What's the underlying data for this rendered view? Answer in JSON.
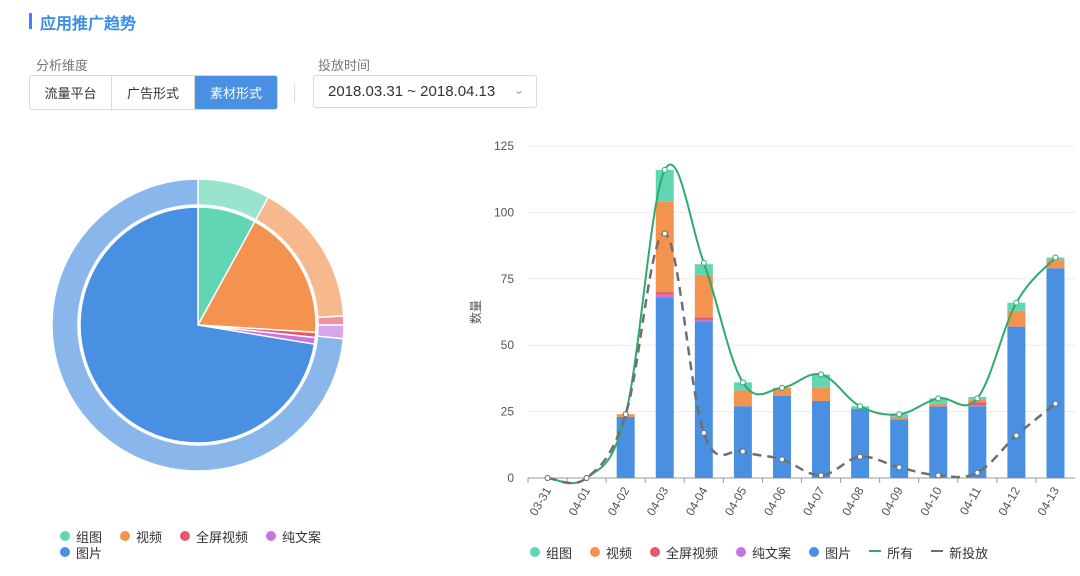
{
  "header": {
    "title": "应用推广趋势"
  },
  "filters": {
    "dimension_label": "分析维度",
    "dimension_options": [
      "流量平台",
      "广告形式",
      "素材形式"
    ],
    "dimension_selected": "素材形式",
    "time_label": "投放时间",
    "date_range": "2018.03.31 ~ 2018.04.13",
    "chevron_icon": "chevron-down-icon"
  },
  "colors": {
    "组图": "#62d5b4",
    "视频": "#f4924f",
    "全屏视频": "#e8586b",
    "纯文案": "#c674e0",
    "图片": "#4a90e2",
    "所有": "#2eab6c",
    "新投放": "#6f6f6f"
  },
  "pie_legend": [
    "组图",
    "视频",
    "全屏视频",
    "纯文案",
    "图片"
  ],
  "bar_legend": [
    "组图",
    "视频",
    "全屏视频",
    "纯文案",
    "图片",
    "所有",
    "新投放"
  ],
  "chart_data": [
    {
      "type": "pie",
      "series": [
        {
          "name": "组图",
          "value": 8
        },
        {
          "name": "视频",
          "value": 18
        },
        {
          "name": "全屏视频",
          "value": 0.7
        },
        {
          "name": "纯文案",
          "value": 0.9
        },
        {
          "name": "图片",
          "value": 72.4
        }
      ],
      "outer_ring": [
        {
          "name": "组图",
          "value": 8
        },
        {
          "name": "视频",
          "value": 16
        },
        {
          "name": "全屏视频",
          "value": 1
        },
        {
          "name": "纯文案",
          "value": 1.5
        },
        {
          "name": "图片",
          "value": 73.5
        }
      ]
    },
    {
      "type": "bar",
      "stacked": true,
      "categories": [
        "03-31",
        "04-01",
        "04-02",
        "04-03",
        "04-04",
        "04-05",
        "04-06",
        "04-07",
        "04-08",
        "04-09",
        "04-10",
        "04-11",
        "04-12",
        "04-13"
      ],
      "ylabel": "数量",
      "ylim": [
        0,
        125
      ],
      "yticks": [
        0,
        25,
        50,
        75,
        100,
        125
      ],
      "grid": true,
      "series": [
        {
          "name": "图片",
          "values": [
            0,
            0,
            23,
            68,
            59,
            27,
            31,
            29,
            26,
            22,
            27,
            27,
            57,
            79
          ]
        },
        {
          "name": "纯文案",
          "values": [
            0,
            0,
            0,
            1,
            0.5,
            0,
            0,
            0,
            0,
            0,
            0,
            0.5,
            0,
            0
          ]
        },
        {
          "name": "全屏视频",
          "values": [
            0,
            0,
            0,
            1,
            1,
            0,
            0,
            0,
            0,
            0,
            0,
            1,
            0,
            0
          ]
        },
        {
          "name": "视频",
          "values": [
            0,
            0,
            1,
            34,
            16,
            6,
            3,
            5,
            0,
            1,
            1,
            1,
            6,
            3
          ]
        },
        {
          "name": "组图",
          "values": [
            0,
            0,
            0,
            12,
            4,
            3,
            0,
            5,
            1,
            1,
            2,
            1,
            3,
            1
          ]
        }
      ],
      "lines": [
        {
          "name": "所有",
          "style": "solid",
          "values": [
            0,
            0,
            24,
            116,
            81,
            36,
            34,
            39,
            27,
            24,
            30,
            30,
            66,
            83
          ]
        },
        {
          "name": "新投放",
          "style": "dashed",
          "values": [
            0,
            0,
            24,
            92,
            17,
            10,
            7,
            1,
            8,
            4,
            1,
            2,
            16,
            28
          ]
        }
      ]
    }
  ]
}
